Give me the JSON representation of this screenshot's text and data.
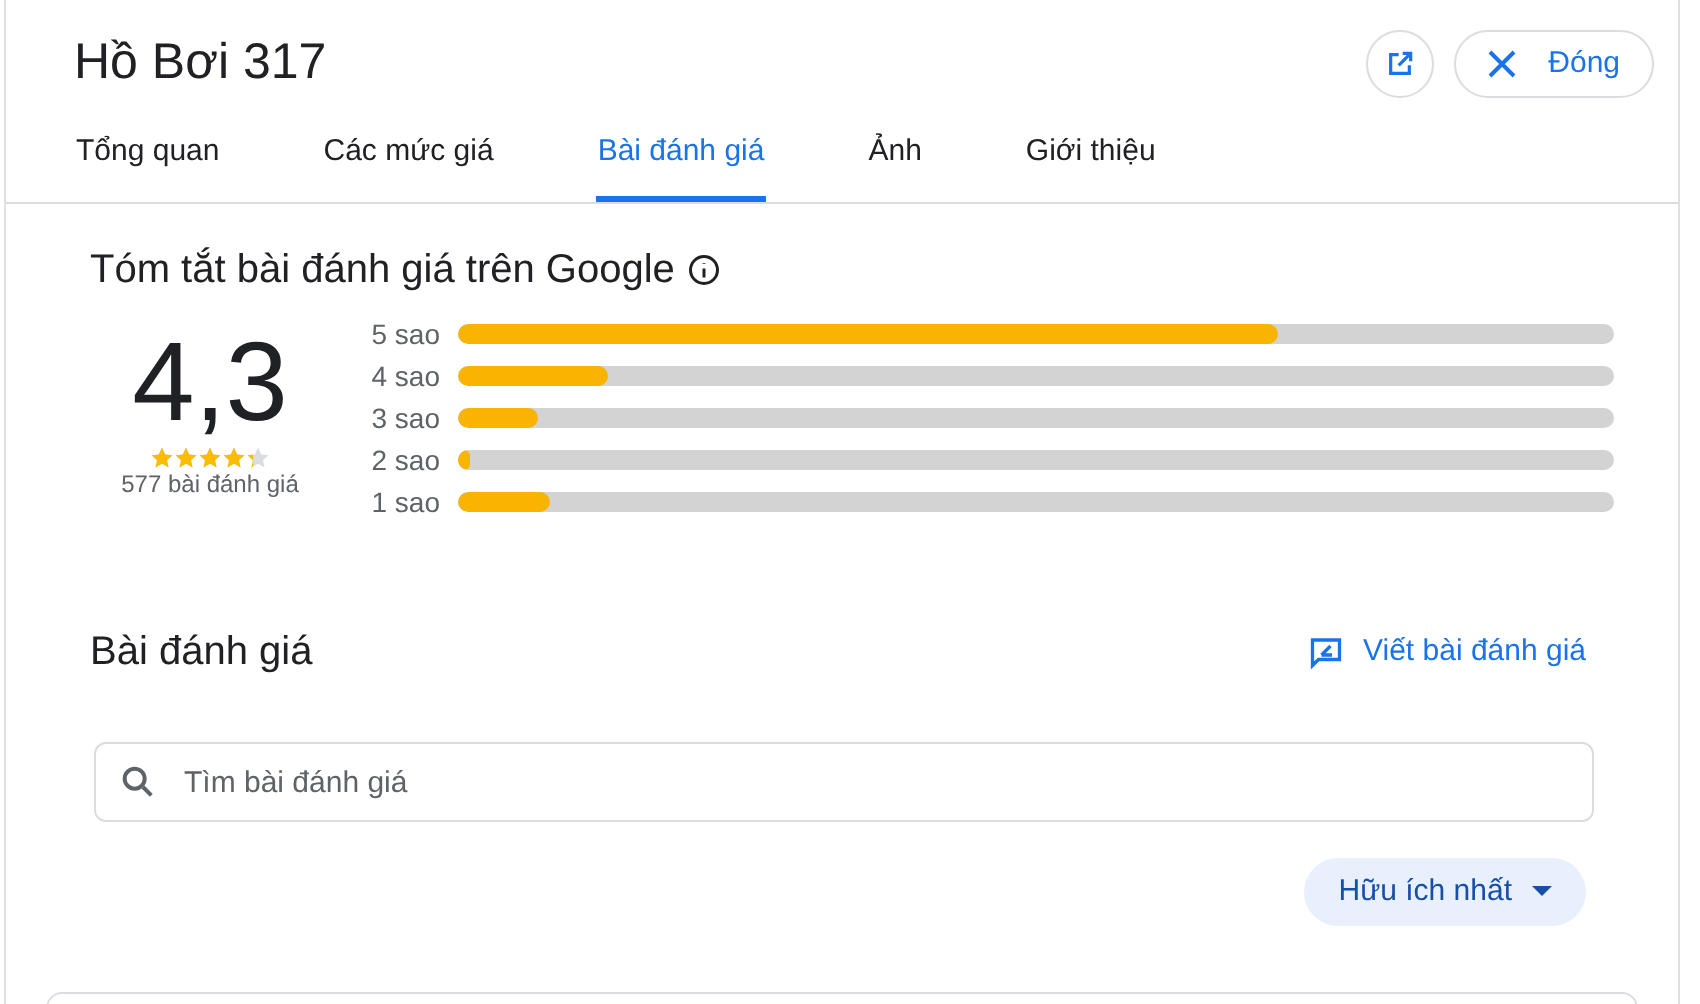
{
  "title": "Hồ Bơi 317",
  "close_label": "Đóng",
  "tabs": [
    {
      "label": "Tổng quan",
      "selected": false
    },
    {
      "label": "Các mức giá",
      "selected": false
    },
    {
      "label": "Bài đánh giá",
      "selected": true
    },
    {
      "label": "Ảnh",
      "selected": false
    },
    {
      "label": "Giới thiệu",
      "selected": false
    }
  ],
  "summary": {
    "heading": "Tóm tắt bài đánh giá trên Google",
    "rating": "4,3",
    "stars": 4.3,
    "count": "577 bài đánh giá",
    "bars": [
      {
        "label": "5 sao",
        "level": 0.71
      },
      {
        "label": "4 sao",
        "level": 0.13
      },
      {
        "label": "3 sao",
        "level": 0.07
      },
      {
        "label": "2 sao",
        "level": 0.01
      },
      {
        "label": "1 sao",
        "level": 0.08
      }
    ]
  },
  "reviews": {
    "heading": "Bài đánh giá",
    "write_label": "Viết bài đánh giá",
    "search_placeholder": "Tìm bài đánh giá",
    "sort_label": "Hữu ích nhất"
  }
}
